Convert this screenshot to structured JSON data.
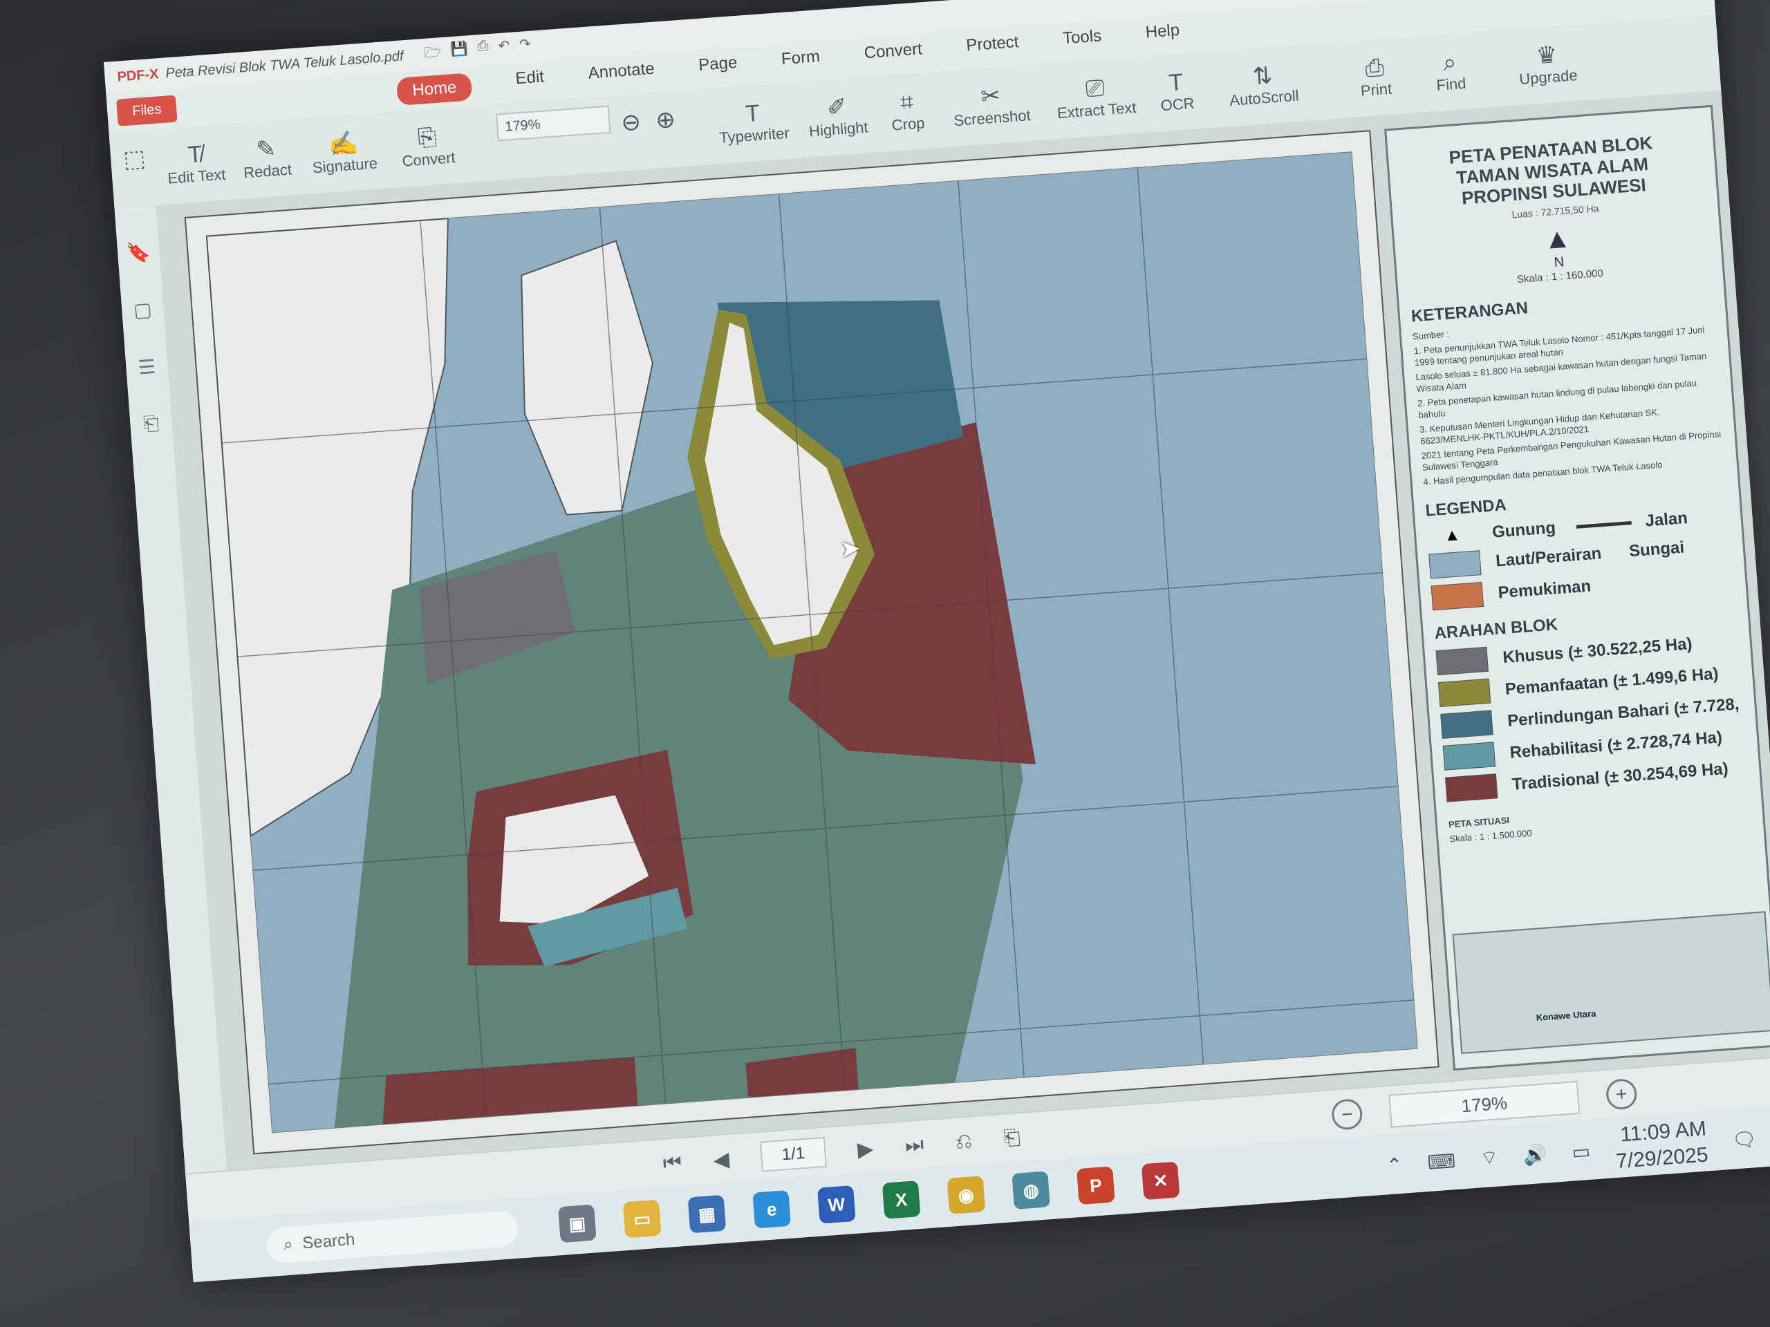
{
  "window": {
    "app_name": "PDF-X",
    "doc_title": "Peta Revisi Blok TWA Teluk Lasolo.pdf"
  },
  "menu": {
    "file": "Files",
    "items": [
      "Home",
      "Edit",
      "Annotate",
      "Page",
      "Form",
      "Convert",
      "Protect",
      "Tools",
      "Help"
    ],
    "active": "Home"
  },
  "right_tools": {
    "autoscroll": "AutoScroll",
    "print": "Print",
    "find": "Find",
    "upgrade": "Upgrade"
  },
  "toolbar": {
    "edit_text": "Edit Text",
    "redact": "Redact",
    "signature": "Signature",
    "convert": "Convert",
    "zoom": "179%",
    "typewriter": "Typewriter",
    "highlight": "Highlight",
    "crop": "Crop",
    "screenshot": "Screenshot",
    "extract_text": "Extract Text",
    "ocr": "OCR"
  },
  "map": {
    "title_line1": "PETA PENATAAN BLOK",
    "title_line2": "TAMAN WISATA ALAM",
    "title_line3": "PROPINSI SULAWESI",
    "luas": "Luas : 72.715,50 Ha",
    "north": "N",
    "skala": "Skala : 1 : 160.000",
    "keterangan_title": "KETERANGAN",
    "sumber": "Sumber :",
    "notes": [
      "1. Peta penunjukkan TWA Teluk Lasolo Nomor : 451/Kpts tanggal 17 Juni 1999 tentang penunjukan areal hutan",
      "Lasolo seluas ± 81.800 Ha sebagai kawasan hutan dengan fungsi Taman Wisata Alam",
      "2. Peta penetapan kawasan hutan lindung di pulau labengki dan pulau bahulu",
      "3. Keputusan Menteri Lingkungan Hidup dan Kehutanan SK. 6623/MENLHK-PKTL/KUH/PLA.2/10/2021",
      "2021 tentang Peta Perkembangan Pengukuhan Kawasan Hutan di Propinsi Sulawesi Tenggara",
      "4. Hasil pengumpulan data penataan blok TWA Teluk Lasolo"
    ],
    "legenda_title": "LEGENDA",
    "legenda": [
      {
        "label": "Gunung",
        "symbol": "▲"
      },
      {
        "label": "Laut/Perairan",
        "color": "#8fb0c4"
      },
      {
        "label": "Pemukiman",
        "color": "#c9734b"
      }
    ],
    "jalan": "Jalan",
    "sungai": "Sungai",
    "arahan_title": "ARAHAN BLOK",
    "arahan": [
      {
        "label": "Khusus (± 30.522,25 Ha)",
        "color": "#6e6f72"
      },
      {
        "label": "Pemanfaatan (± 1.499,6 Ha)",
        "color": "#8a8a3a"
      },
      {
        "label": "Perlindungan Bahari (± 7.728,",
        "color": "#3f6f82"
      },
      {
        "label": "Rehabilitasi (± 2.728,74 Ha)",
        "color": "#5e99a4"
      },
      {
        "label": "Tradisional (± 30.254,69 Ha)",
        "color": "#7a3b3e"
      }
    ],
    "peta_situasi": "PETA SITUASI",
    "peta_situasi_skala": "Skala : 1 : 1.500.000",
    "inset_label": "Konawe Utara"
  },
  "navigation": {
    "page": "1/1",
    "zoom": "179%"
  },
  "taskbar": {
    "search": "Search",
    "time": "11:09 AM",
    "date": "7/29/2025"
  },
  "colors": {
    "accent": "#d8534a",
    "sea": "#8fb0c4",
    "block_khusus": "#6e6f72",
    "block_tradisional": "#7a3b3e",
    "block_green": "#5f8578"
  }
}
